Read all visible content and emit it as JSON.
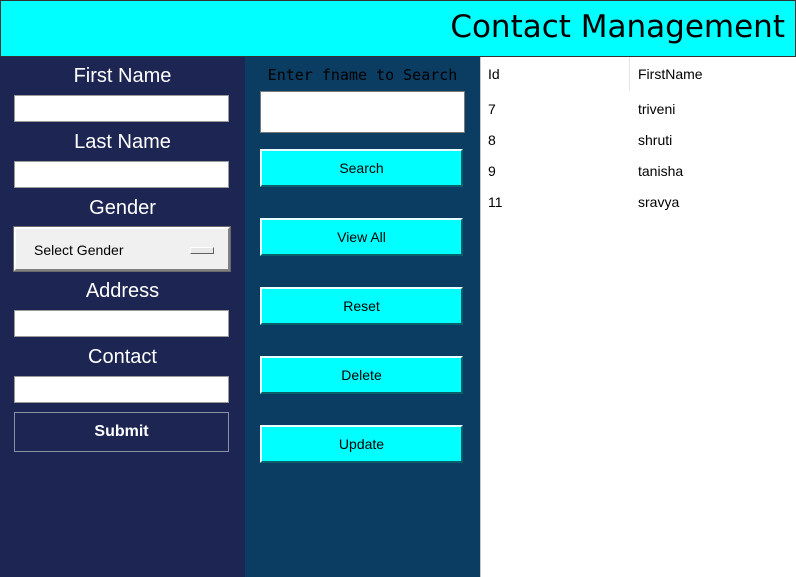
{
  "header": {
    "title": "Contact Management"
  },
  "form": {
    "first_name_label": "First Name",
    "last_name_label": "Last Name",
    "gender_label": "Gender",
    "gender_selected": "Select Gender",
    "address_label": "Address",
    "contact_label": "Contact",
    "submit_label": "Submit"
  },
  "search": {
    "label": "Enter fname to Search",
    "buttons": {
      "search": "Search",
      "view_all": "View All",
      "reset": "Reset",
      "delete": "Delete",
      "update": "Update"
    }
  },
  "table": {
    "columns": [
      "Id",
      "FirstName"
    ],
    "rows": [
      [
        "7",
        "triveni"
      ],
      [
        "8",
        "shruti"
      ],
      [
        "9",
        "tanisha"
      ],
      [
        "11",
        "sravya"
      ]
    ]
  },
  "colors": {
    "accent": "#00ffff",
    "left_panel": "#1d2652",
    "middle_panel": "#0b3d63"
  }
}
